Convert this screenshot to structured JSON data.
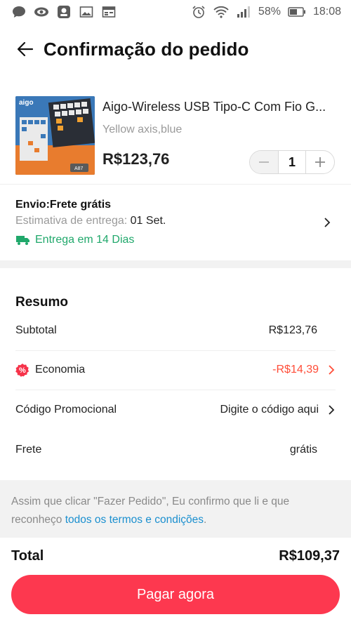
{
  "status_bar": {
    "left_icons": [
      "chat-icon",
      "eye-icon",
      "app-icon",
      "image-icon",
      "calendar-icon"
    ],
    "right_icons": [
      "alarm-icon",
      "wifi-icon",
      "signal-icon",
      "battery-icon"
    ],
    "battery": "58%",
    "time": "18:08"
  },
  "header": {
    "title": "Confirmação do pedido"
  },
  "product": {
    "title": "Aigo-Wireless USB Tipo-C Com Fio G...",
    "variant": "Yellow axis,blue",
    "price": "R$123,76",
    "quantity": "1",
    "image_labels": {
      "brand": "aigo",
      "model": "A87"
    }
  },
  "shipping": {
    "title": "Envio:Frete grátis",
    "estimate_label": "Estimativa de entrega:",
    "estimate_value": "01 Set.",
    "fast_delivery": "Entrega em 14 Dias"
  },
  "summary": {
    "title": "Resumo",
    "subtotal_label": "Subtotal",
    "subtotal_value": "R$123,76",
    "savings_label": "Economia",
    "savings_value": "-R$14,39",
    "promo_label": "Código Promocional",
    "promo_value": "Digite o código aqui",
    "shipping_label": "Frete",
    "shipping_value": "grátis"
  },
  "terms": {
    "text": "Assim que clicar \"Fazer Pedido\", Eu confirmo que li e que reconheço ",
    "link": "todos os termos e condições",
    "end": "."
  },
  "footer": {
    "total_label": "Total",
    "total_value": "R$109,37",
    "pay_button": "Pagar agora"
  },
  "colors": {
    "accent": "#fd384f",
    "discount": "#ff4d38",
    "delivery_green": "#20a86b",
    "link": "#1a8fcf"
  }
}
